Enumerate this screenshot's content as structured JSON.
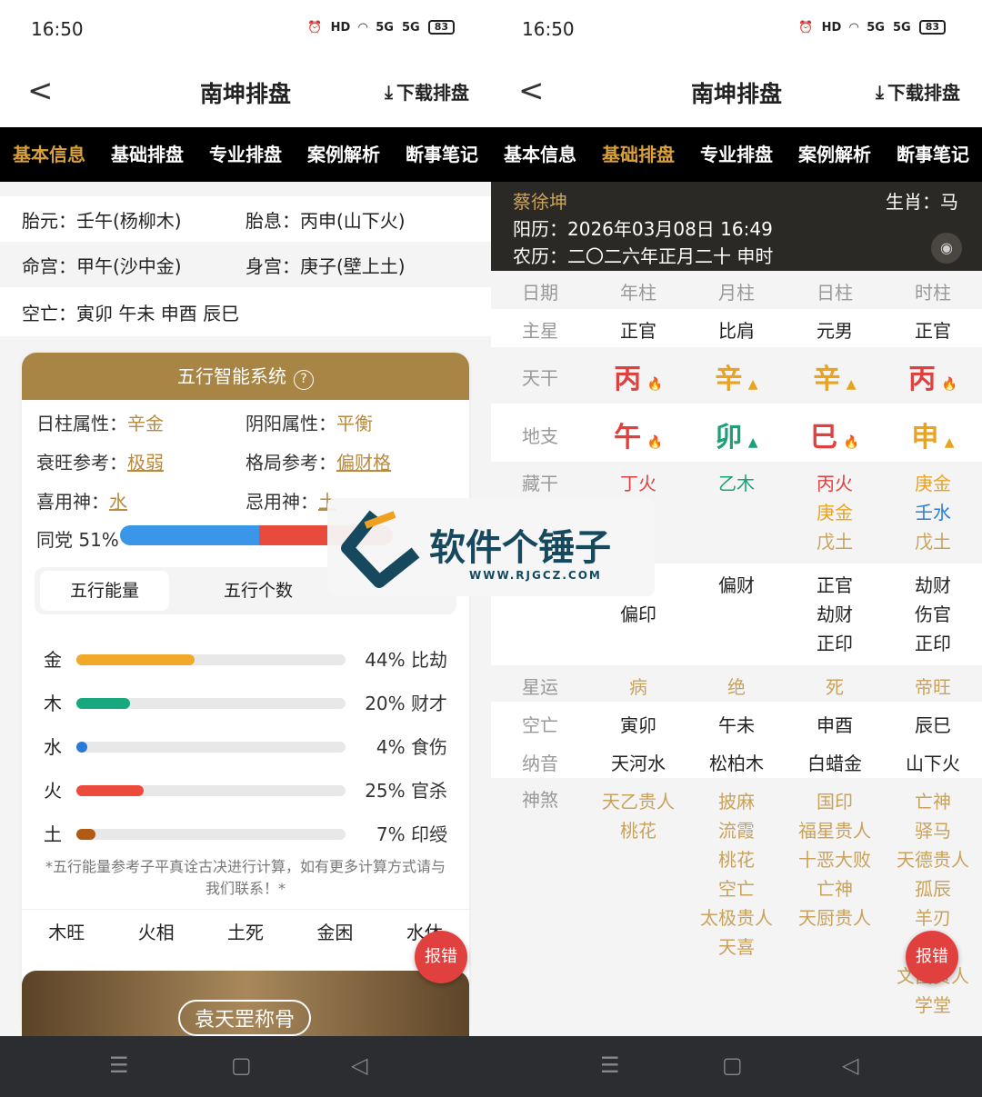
{
  "status": {
    "time": "16:50",
    "icons": [
      "alarm-icon",
      "hd-icon",
      "wifi-icon",
      "5g-signal-icon",
      "5g-signal-icon",
      "battery-icon"
    ],
    "battery": "83",
    "hd": "HD",
    "five_g": "5G"
  },
  "header": {
    "title": "南坤排盘",
    "download": "下载排盘",
    "back": "<"
  },
  "tabs": [
    "基本信息",
    "基础排盘",
    "专业排盘",
    "案例解析",
    "断事笔记"
  ],
  "left": {
    "rows": [
      {
        "a": "胎元：壬午(杨柳木)",
        "b": "胎息：丙申(山下火)"
      },
      {
        "a": "命宫：甲午(沙中金)",
        "b": "身宫：庚子(壁上土)"
      },
      {
        "a": "空亡：寅卯 午未 申酉 辰巳",
        "b": ""
      }
    ],
    "card_title": "五行智能系统",
    "help": "?",
    "attrs": {
      "rizhu_label": "日柱属性：",
      "rizhu": "辛金",
      "yinyang_label": "阴阳属性：",
      "yinyang": "平衡",
      "shuaiwang_label": "衰旺参考：",
      "shuaiwang": "极弱",
      "geju_label": "格局参考：",
      "geju": "偏财格",
      "xiyong_label": "喜用神：",
      "xiyong": "水",
      "jishen_label": "忌用神：",
      "jishen": "土"
    },
    "tongdang": "同党 51%",
    "tongdang_value": 51,
    "seg_energy": "五行能量",
    "seg_count": "五行个数",
    "elements": [
      {
        "name": "金",
        "pct": 44,
        "text": "44% 比劫",
        "color": "#f0a928"
      },
      {
        "name": "木",
        "pct": 20,
        "text": "20% 财才",
        "color": "#17a87e"
      },
      {
        "name": "水",
        "pct": 4,
        "text": "4% 食伤",
        "color": "#2a78d8"
      },
      {
        "name": "火",
        "pct": 25,
        "text": "25% 官杀",
        "color": "#ec4b3b"
      },
      {
        "name": "土",
        "pct": 7,
        "text": "7% 印绶",
        "color": "#b05a14"
      }
    ],
    "note": "*五行能量参考子平真诠古决进行计算，如有更多计算方式请与我们联系！*",
    "states": [
      "木旺",
      "火相",
      "土死",
      "金困",
      "水休"
    ],
    "banner": "袁天罡称骨",
    "report": "报错"
  },
  "watermark": {
    "title": "软件个锤子",
    "url": "WWW.RJGCZ.COM"
  },
  "right": {
    "name": "蔡徐坤",
    "zodiac": "生肖：马",
    "solar": "阳历：2026年03月08日 16:49",
    "lunar": "农历：二〇二六年正月二十 申时",
    "headers": [
      "日期",
      "年柱",
      "月柱",
      "日柱",
      "时柱"
    ],
    "zhuxing_label": "主星",
    "zhuxing": [
      "正官",
      "比肩",
      "元男",
      "正官"
    ],
    "tiangan_label": "天干",
    "tiangan": [
      {
        "c": "丙",
        "i": "🔥",
        "cls": "red"
      },
      {
        "c": "辛",
        "i": "▲",
        "cls": "yel"
      },
      {
        "c": "辛",
        "i": "▲",
        "cls": "yel"
      },
      {
        "c": "丙",
        "i": "🔥",
        "cls": "red"
      }
    ],
    "dizhi_label": "地支",
    "dizhi": [
      {
        "c": "午",
        "i": "🔥",
        "cls": "red"
      },
      {
        "c": "卯",
        "i": "▲",
        "cls": "grn"
      },
      {
        "c": "巳",
        "i": "🔥",
        "cls": "red"
      },
      {
        "c": "申",
        "i": "▲",
        "cls": "yel"
      }
    ],
    "canggan_label": "藏干",
    "canggan": [
      [
        {
          "t": "丁火",
          "cls": "red"
        }
      ],
      [
        {
          "t": "乙木",
          "cls": "grn"
        }
      ],
      [
        {
          "t": "丙火",
          "cls": "red"
        },
        {
          "t": "庚金",
          "cls": "yel"
        },
        {
          "t": "戊土",
          "cls": "cg"
        }
      ],
      [
        {
          "t": "庚金",
          "cls": "yel"
        },
        {
          "t": "壬水",
          "cls": "blu"
        },
        {
          "t": "戊土",
          "cls": "cg"
        }
      ]
    ],
    "fuxing": [
      [
        "偏印"
      ],
      [
        "偏财"
      ],
      [
        "正官",
        "劫财",
        "正印"
      ],
      [
        "劫财",
        "伤官",
        "正印"
      ]
    ],
    "xingyun_label": "星运",
    "xingyun": [
      "病",
      "绝",
      "死",
      "帝旺"
    ],
    "kongwang_label": "空亡",
    "kongwang": [
      "寅卯",
      "午未",
      "申酉",
      "辰巳"
    ],
    "nayin_label": "纳音",
    "nayin": [
      "天河水",
      "松柏木",
      "白蜡金",
      "山下火"
    ],
    "shensha_label": "神煞",
    "shensha": [
      [
        "天乙贵人",
        "桃花"
      ],
      [
        "披麻",
        "流霞",
        "桃花",
        "空亡",
        "太极贵人",
        "天喜"
      ],
      [
        "国印",
        "福星贵人",
        "十恶大败",
        "亡神",
        "天厨贵人"
      ],
      [
        "亡神",
        "驿马",
        "天德贵人",
        "孤辰",
        "羊刃",
        "",
        "文昌贵人",
        "学堂"
      ]
    ],
    "report": "报错"
  },
  "nav": [
    "☰",
    "▢",
    "◁"
  ]
}
